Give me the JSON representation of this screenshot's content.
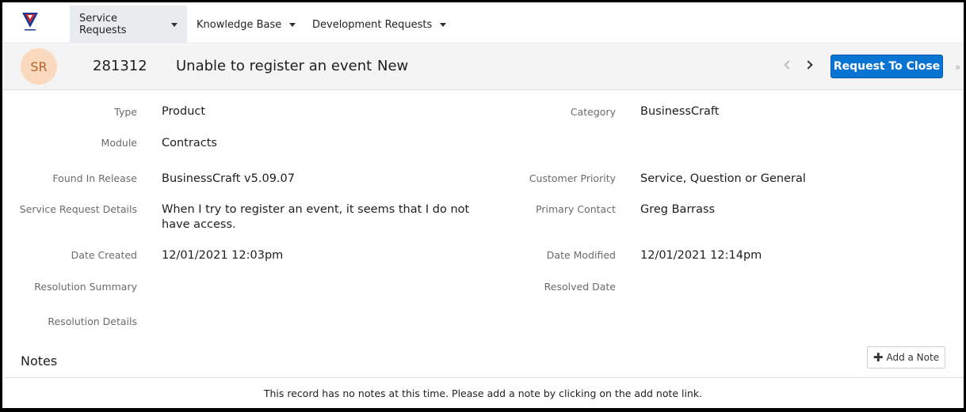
{
  "nav": {
    "items": [
      {
        "label": "Service Requests",
        "active": true
      },
      {
        "label": "Knowledge Base",
        "active": false
      },
      {
        "label": "Development Requests",
        "active": false
      }
    ]
  },
  "header": {
    "avatar": "SR",
    "record_id": "281312",
    "title": "Unable to register an event",
    "status": "New",
    "request_close_label": "Request To Close"
  },
  "fields": {
    "type_label": "Type",
    "type": "Product",
    "category_label": "Category",
    "category": "BusinessCraft",
    "module_label": "Module",
    "module": "Contracts",
    "found_label": "Found In Release",
    "found": "BusinessCraft v5.09.07",
    "priority_label": "Customer Priority",
    "priority": "Service, Question or General",
    "details_label": "Service Request Details",
    "details": "When I try to register an event, it seems that I do not have access.",
    "contact_label": "Primary Contact",
    "contact": "Greg Barrass",
    "created_label": "Date Created",
    "created": "12/01/2021 12:03pm",
    "modified_label": "Date Modified",
    "modified": "12/01/2021 12:14pm",
    "res_summary_label": "Resolution Summary",
    "resolved_label": "Resolved Date",
    "res_details_label": "Resolution Details"
  },
  "notes": {
    "title": "Notes",
    "add_label": "Add a Note",
    "empty_message": "This record has no notes at this time. Please add a note by clicking on the add note link."
  },
  "colors": {
    "accent": "#0a74d3",
    "avatar_bg": "#fbd9bf",
    "avatar_text": "#b4622c"
  }
}
